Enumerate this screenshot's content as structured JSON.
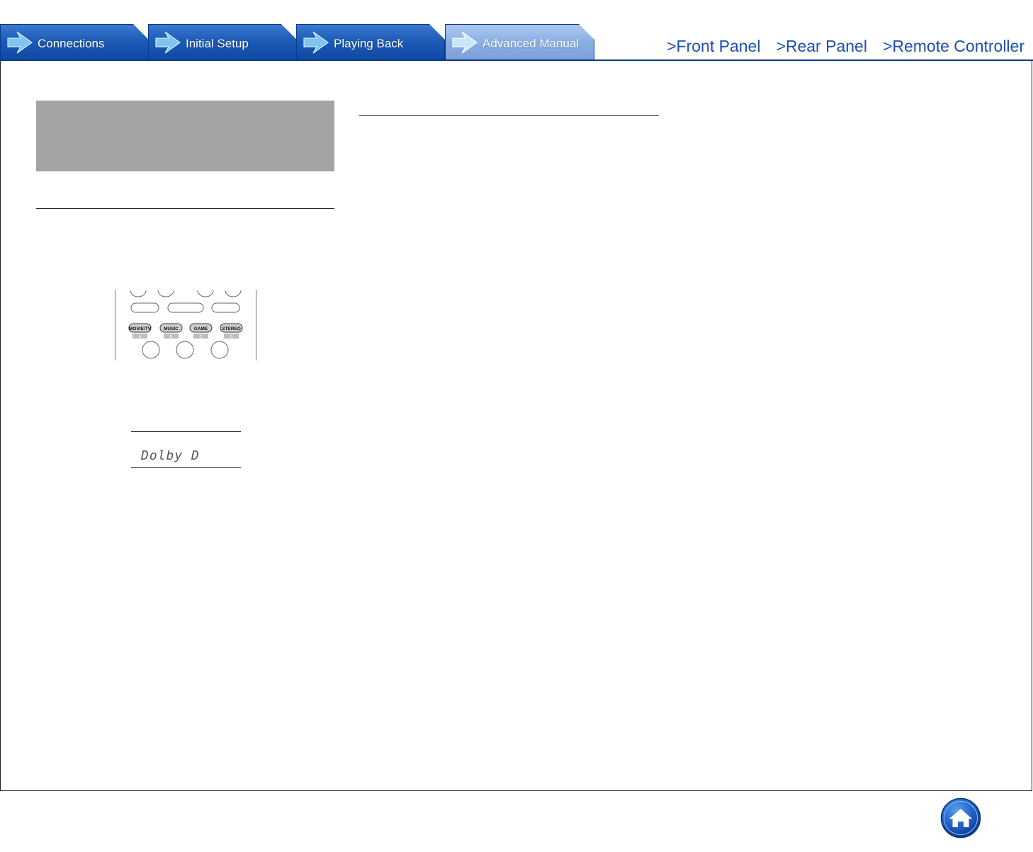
{
  "tabs": [
    {
      "label": "Connections",
      "active": false
    },
    {
      "label": "Initial Setup",
      "active": false
    },
    {
      "label": "Playing Back",
      "active": false
    },
    {
      "label": "Advanced Manual",
      "active": true
    }
  ],
  "quick_links": [
    {
      "label": ">Front Panel"
    },
    {
      "label": ">Rear Panel"
    },
    {
      "label": ">Remote Controller"
    }
  ],
  "remote": {
    "buttons": [
      {
        "label": "MOVIE/TV",
        "sub": "A"
      },
      {
        "label": "MUSIC",
        "sub": "B"
      },
      {
        "label": "GAME",
        "sub": "C"
      },
      {
        "label": "STEREO",
        "sub": "D"
      }
    ]
  },
  "display": {
    "text": "Dolby D"
  },
  "colors": {
    "tab_blue": "#1d5bb6",
    "tab_active": "#8aaee3",
    "link_blue": "#1b4fb0",
    "grey_box": "#a4a4a2"
  },
  "icons": {
    "tab_arrow": "arrow-right-icon",
    "home": "home-icon"
  }
}
